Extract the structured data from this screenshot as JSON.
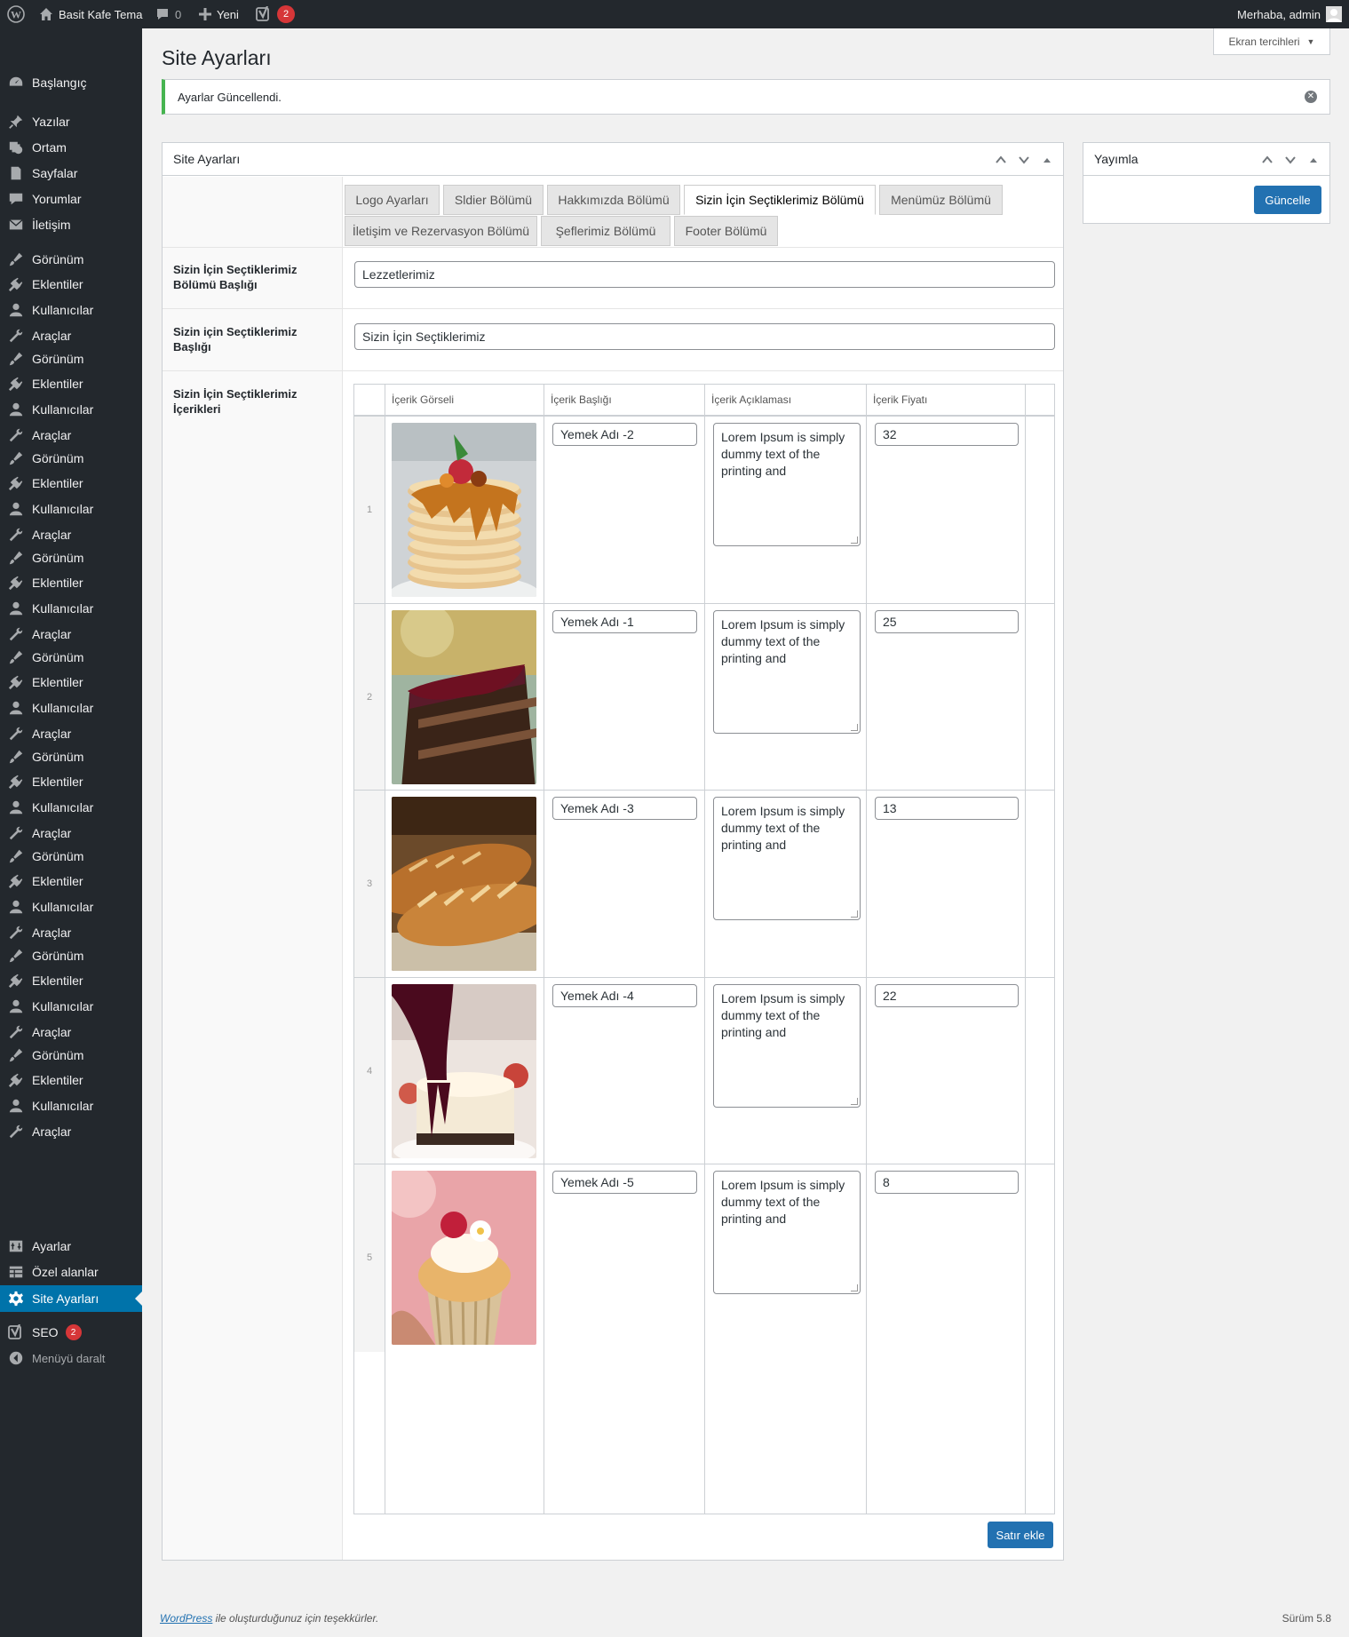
{
  "adminbar": {
    "site_name": "Basit Kafe Tema",
    "comments_count": "0",
    "new_label": "Yeni",
    "seo_badge": "2",
    "greeting": "Merhaba, admin"
  },
  "sidebar": {
    "items": [
      {
        "label": "Başlangıç",
        "icon": "dashboard-icon"
      },
      {
        "label": "Yazılar",
        "icon": "pin-icon"
      },
      {
        "label": "Ortam",
        "icon": "media-icon"
      },
      {
        "label": "Sayfalar",
        "icon": "page-icon"
      },
      {
        "label": "Yorumlar",
        "icon": "comment-icon"
      },
      {
        "label": "İletişim",
        "icon": "mail-icon"
      },
      {
        "label": "Görünüm",
        "icon": "brush-icon"
      },
      {
        "label": "Eklentiler",
        "icon": "plugin-icon"
      },
      {
        "label": "Kullanıcılar",
        "icon": "user-icon"
      },
      {
        "label": "Araçlar",
        "icon": "wrench-icon"
      },
      {
        "label": "Görünüm",
        "icon": "brush-icon"
      },
      {
        "label": "Eklentiler",
        "icon": "plugin-icon"
      },
      {
        "label": "Kullanıcılar",
        "icon": "user-icon"
      },
      {
        "label": "Araçlar",
        "icon": "wrench-icon"
      },
      {
        "label": "Görünüm",
        "icon": "brush-icon"
      },
      {
        "label": "Eklentiler",
        "icon": "plugin-icon"
      },
      {
        "label": "Kullanıcılar",
        "icon": "user-icon"
      },
      {
        "label": "Araçlar",
        "icon": "wrench-icon"
      },
      {
        "label": "Görünüm",
        "icon": "brush-icon"
      },
      {
        "label": "Eklentiler",
        "icon": "plugin-icon"
      },
      {
        "label": "Kullanıcılar",
        "icon": "user-icon"
      },
      {
        "label": "Araçlar",
        "icon": "wrench-icon"
      },
      {
        "label": "Görünüm",
        "icon": "brush-icon"
      },
      {
        "label": "Eklentiler",
        "icon": "plugin-icon"
      },
      {
        "label": "Kullanıcılar",
        "icon": "user-icon"
      },
      {
        "label": "Araçlar",
        "icon": "wrench-icon"
      },
      {
        "label": "Görünüm",
        "icon": "brush-icon"
      },
      {
        "label": "Eklentiler",
        "icon": "plugin-icon"
      },
      {
        "label": "Kullanıcılar",
        "icon": "user-icon"
      },
      {
        "label": "Araçlar",
        "icon": "wrench-icon"
      },
      {
        "label": "Görünüm",
        "icon": "brush-icon"
      },
      {
        "label": "Eklentiler",
        "icon": "plugin-icon"
      },
      {
        "label": "Kullanıcılar",
        "icon": "user-icon"
      },
      {
        "label": "Araçlar",
        "icon": "wrench-icon"
      },
      {
        "label": "Görünüm",
        "icon": "brush-icon"
      },
      {
        "label": "Eklentiler",
        "icon": "plugin-icon"
      },
      {
        "label": "Kullanıcılar",
        "icon": "user-icon"
      },
      {
        "label": "Araçlar",
        "icon": "wrench-icon"
      },
      {
        "label": "Görünüm",
        "icon": "brush-icon"
      },
      {
        "label": "Eklentiler",
        "icon": "plugin-icon"
      },
      {
        "label": "Kullanıcılar",
        "icon": "user-icon"
      },
      {
        "label": "Araçlar",
        "icon": "wrench-icon"
      },
      {
        "label": "Ayarlar",
        "icon": "settings-icon"
      },
      {
        "label": "Özel alanlar",
        "icon": "table-icon"
      },
      {
        "label": "Site Ayarları",
        "icon": "gear-icon",
        "current": true
      },
      {
        "label": "SEO",
        "icon": "yoast-icon",
        "badge": "2"
      },
      {
        "label": "Menüyü daralt",
        "icon": "collapse-icon"
      }
    ]
  },
  "screen_options": "Ekran tercihleri",
  "page_title": "Site Ayarları",
  "notice": "Ayarlar Güncellendi.",
  "settings_box": {
    "title": "Site Ayarları",
    "tabs": [
      "Logo Ayarları",
      "Sldier Bölümü",
      "Hakkımızda Bölümü",
      "Sizin İçin Seçtiklerimiz Bölümü",
      "Menümüz Bölümü",
      "İletişim ve Rezervasyon Bölümü",
      "Şeflerimiz Bölümü",
      "Footer Bölümü"
    ],
    "active_tab": "Sizin İçin Seçtiklerimiz Bölümü",
    "fields": [
      {
        "label": "Sizin İçin Seçtiklerimiz Bölümü Başlığı",
        "value": "Lezzetlerimiz"
      },
      {
        "label": "Sizin için Seçtiklerimiz Başlığı",
        "value": "Sizin İçin Seçtiklerimiz"
      },
      {
        "label": "Sizin İçin Seçtiklerimiz İçerikleri"
      }
    ],
    "repeater": {
      "columns": [
        "İçerik Görseli",
        "İçerik Başlığı",
        "İçerik Açıklaması",
        "İçerik Fiyatı"
      ],
      "rows": [
        {
          "num": "1",
          "title": "Yemek Adı -2",
          "desc": "Lorem Ipsum is simply\ndummy text of the\nprinting and",
          "price": "32",
          "image": "pancakes-image"
        },
        {
          "num": "2",
          "title": "Yemek Adı -1",
          "desc": "Lorem Ipsum is simply\ndummy text of the\nprinting and",
          "price": "25",
          "image": "chocolate-cake-image"
        },
        {
          "num": "3",
          "title": "Yemek Adı -3",
          "desc": "Lorem Ipsum is simply\ndummy text of the\nprinting and",
          "price": "13",
          "image": "bread-image"
        },
        {
          "num": "4",
          "title": "Yemek Adı -4",
          "desc": "Lorem Ipsum is simply\ndummy text of the\nprinting and",
          "price": "22",
          "image": "cheesecake-image"
        },
        {
          "num": "5",
          "title": "Yemek Adı -5",
          "desc": "Lorem Ipsum is simply\ndummy text of the\nprinting and",
          "price": "8",
          "image": "cupcake-image"
        }
      ],
      "add_row_label": "Satır ekle"
    }
  },
  "publish_box": {
    "title": "Yayımla",
    "update_label": "Güncelle"
  },
  "footer": {
    "wordpress_link": "WordPress",
    "thanks": " ile oluşturduğunuz için teşekkürler.",
    "version": "Sürüm 5.8"
  },
  "colors": {
    "admin_dark": "#23282d",
    "accent": "#0073aa",
    "button": "#2271b1",
    "notice_success": "#46b450",
    "badge": "#d63638"
  }
}
